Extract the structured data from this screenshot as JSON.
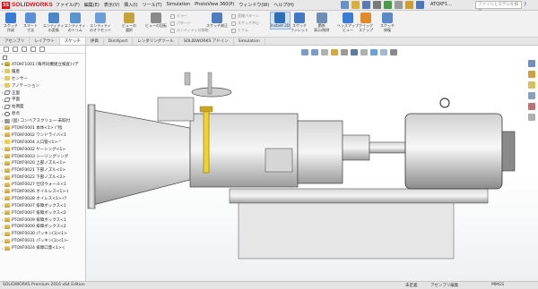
{
  "app": {
    "logo_badge": "3S",
    "logo_text": "SOLIDWORKS",
    "doc_title": "ATOXF1...",
    "search_placeholder": "ファイルとモデルを検索",
    "help": "?"
  },
  "menu": [
    "ファイル(F)",
    "編集(E)",
    "表示(V)",
    "挿入(I)",
    "ツール(T)",
    "Simulation",
    "PhotoView 360(P)",
    "ウィンドウ(W)",
    "ヘルプ(H)"
  ],
  "commands": {
    "large": [
      {
        "label": "スケッチ\n作成",
        "color": "#3a7bd5"
      },
      {
        "label": "スマート\n寸法",
        "color": "#5b8fd6"
      },
      {
        "label": "エンティティ\nの変換",
        "color": "#4a88c9"
      },
      {
        "label": "エンティティ\nのトリム",
        "color": "#5a95d0"
      },
      {
        "label": "エンティティ\nのオフセット",
        "color": "#6a9fd8"
      },
      {
        "label": "ビューの\n選択",
        "color": "#c7a43a"
      },
      {
        "label": "ビューの回転",
        "color": "#8a8a8a"
      },
      {
        "label": "スケッチ修正",
        "color": "#4f7ec0"
      },
      {
        "label": "Instant 2D",
        "color": "#2f6db5"
      },
      {
        "label": "スケッチ\nフィレット",
        "color": "#3f7ac2"
      },
      {
        "label": "関係\n表示/削除",
        "color": "#6c8fb8"
      },
      {
        "label": "ヘッズアップ\nビュー",
        "color": "#3a7bd5"
      },
      {
        "label": "クイック\nスナップ",
        "color": "#e08a2a"
      },
      {
        "label": "スケッチ\n修復",
        "color": "#5a88c8"
      }
    ],
    "small": [
      "ミラー",
      "パターン",
      "エンティティの移動",
      "直線パターン",
      "スケッチ中心",
      "トリム"
    ]
  },
  "tabs": [
    "アセンブリ",
    "レイアウト",
    "スケッチ",
    "評価",
    "DimXpert",
    "レンダリングツール",
    "SOLIDWORKS アドイン",
    "Simulation"
  ],
  "active_tab": "スケッチ",
  "tree": {
    "root": "ATOXF1001 [毎月同機組立検査]-(デ",
    "items": [
      {
        "icon": "folder",
        "label": "履歴"
      },
      {
        "icon": "folder",
        "label": "センサー"
      },
      {
        "icon": "folder",
        "label": "アノテーション"
      },
      {
        "icon": "plane",
        "label": "正面"
      },
      {
        "icon": "plane",
        "label": "平面"
      },
      {
        "icon": "plane",
        "label": "右側面"
      },
      {
        "icon": "origin",
        "label": "原点"
      },
      {
        "icon": "mate",
        "label": "(固) コンベアスクリュー-未取付"
      },
      {
        "icon": "part",
        "label": "PTOXF0001 本体<1> (\"指"
      },
      {
        "icon": "part",
        "label": "PTOXF0002 ワンドライバ<1"
      },
      {
        "icon": "yellow",
        "label": "PTOXF0004 入口管<1>-\""
      },
      {
        "icon": "part",
        "label": "PTOXF0002 ケーシング<1>"
      },
      {
        "icon": "part",
        "label": "PTOXF0003 シーリングリング"
      },
      {
        "icon": "part",
        "label": "PTOXF0020 上部ノズル<1>"
      },
      {
        "icon": "part",
        "label": "PTOXF0021 下部ノズル<1>"
      },
      {
        "icon": "part",
        "label": "PTOXF0022 下部ノズル<2>"
      },
      {
        "icon": "part",
        "label": "PTOXF0027 仕切ウォール<1"
      },
      {
        "icon": "part",
        "label": "PTOXF0026 オイルレス<1>-("
      },
      {
        "icon": "part",
        "label": "PTOXF0028 オイレス<1>-(?"
      },
      {
        "icon": "part",
        "label": "PTOXF0007 排障ボックス<1"
      },
      {
        "icon": "part",
        "label": "PTOXF0007 排障ボックス<2"
      },
      {
        "icon": "part",
        "label": "PTOXF0009 排障ボックス<1"
      },
      {
        "icon": "part",
        "label": "PTOXF0009 排障ボックス<2"
      },
      {
        "icon": "part",
        "label": "PTOXF0030 パッキン(1)<1>"
      },
      {
        "icon": "part",
        "label": "PTOXF0031 パッキン(1)<1>-"
      },
      {
        "icon": "part",
        "label": "PTOXF0024 排障口蓋<1>-("
      }
    ]
  },
  "status": {
    "left": "SOLIDWORKS Premium 2016 x64 Edition",
    "mid": "未定義",
    "mid2": "アセンブリ編集",
    "right": "MMGS"
  }
}
